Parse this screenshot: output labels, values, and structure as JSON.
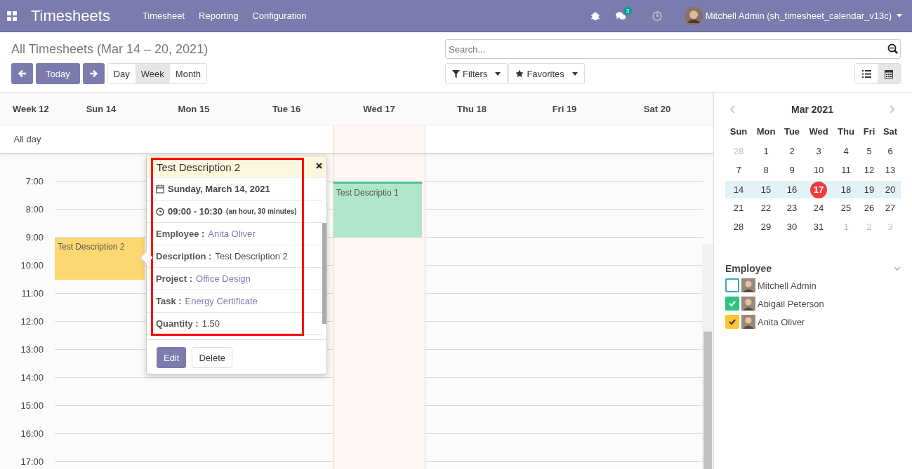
{
  "navbar": {
    "app_title": "Timesheets",
    "menus": [
      "Timesheet",
      "Reporting",
      "Configuration"
    ],
    "messages_count": "3",
    "user": "Mitchell Admin (sh_timesheet_calendar_v13c)"
  },
  "control_panel": {
    "title": "All Timesheets (Mar 14 – 20, 2021)",
    "today_button": "Today",
    "view_modes": [
      {
        "label": "Day",
        "selected": false
      },
      {
        "label": "Week",
        "selected": true
      },
      {
        "label": "Month",
        "selected": false
      }
    ],
    "search": {
      "placeholder": "Search..."
    },
    "filter_buttons": [
      {
        "kind": "filter",
        "label": "Filters"
      },
      {
        "kind": "star",
        "label": "Favorites"
      }
    ],
    "view_switch": [
      {
        "kind": "list",
        "selected": false
      },
      {
        "kind": "calendar",
        "selected": true
      }
    ]
  },
  "calendar": {
    "week_label": "Week 12",
    "all_day_label": "All day",
    "days": [
      {
        "label": "Sun 14",
        "today": false,
        "events": [
          {
            "title": "Test Description 2",
            "color": "#fcd872"
          }
        ]
      },
      {
        "label": "Mon 15",
        "today": false
      },
      {
        "label": "Tue 16",
        "today": false
      },
      {
        "label": "Wed 17",
        "today": true,
        "events": [
          {
            "title": "Test Descriptio 1",
            "color": "#b0e6cc"
          }
        ]
      },
      {
        "label": "Thu 18",
        "today": false
      },
      {
        "label": "Fri 19",
        "today": false
      },
      {
        "label": "Sat 20",
        "today": false
      }
    ],
    "hours": [
      "7:00",
      "8:00",
      "9:00",
      "10:00",
      "11:00",
      "12:00",
      "13:00",
      "14:00",
      "15:00",
      "16:00",
      "17:00"
    ]
  },
  "popover": {
    "title": "Test Description 2",
    "highlighted": true,
    "date": "Sunday, March 14, 2021",
    "time": "09:00 - 10:30",
    "duration": "(an hour, 30 minutes)",
    "fields": [
      {
        "label": "Employee :",
        "value": "Anita Oliver",
        "kind": "link"
      },
      {
        "label": "Description :",
        "value": "Test Description 2",
        "kind": "text"
      },
      {
        "label": "Project :",
        "value": "Office Design",
        "kind": "link"
      },
      {
        "label": "Task :",
        "value": "Energy Certificate",
        "kind": "link"
      },
      {
        "label": "Quantity :",
        "value": "1.50",
        "kind": "text"
      }
    ],
    "buttons": [
      {
        "label": "Edit",
        "kind": "primary"
      },
      {
        "label": "Delete",
        "kind": "secondary"
      }
    ]
  },
  "sidebar": {
    "month": "Mar 2021",
    "weekdays": [
      "Sun",
      "Mon",
      "Tue",
      "Wed",
      "Thu",
      "Fri",
      "Sat"
    ],
    "weeks": [
      {
        "selected": false,
        "days": [
          {
            "label": "28",
            "muted": true,
            "today": false
          },
          {
            "label": "1",
            "muted": false,
            "today": false
          },
          {
            "label": "2",
            "muted": false,
            "today": false
          },
          {
            "label": "3",
            "muted": false,
            "today": false
          },
          {
            "label": "4",
            "muted": false,
            "today": false
          },
          {
            "label": "5",
            "muted": false,
            "today": false
          },
          {
            "label": "6",
            "muted": false,
            "today": false
          }
        ]
      },
      {
        "selected": false,
        "days": [
          {
            "label": "7",
            "muted": false,
            "today": false
          },
          {
            "label": "8",
            "muted": false,
            "today": false
          },
          {
            "label": "9",
            "muted": false,
            "today": false
          },
          {
            "label": "10",
            "muted": false,
            "today": false
          },
          {
            "label": "11",
            "muted": false,
            "today": false
          },
          {
            "label": "12",
            "muted": false,
            "today": false
          },
          {
            "label": "13",
            "muted": false,
            "today": false
          }
        ]
      },
      {
        "selected": true,
        "days": [
          {
            "label": "14",
            "muted": false,
            "today": false
          },
          {
            "label": "15",
            "muted": false,
            "today": false
          },
          {
            "label": "16",
            "muted": false,
            "today": false
          },
          {
            "label": "17",
            "muted": false,
            "today": true
          },
          {
            "label": "18",
            "muted": false,
            "today": false
          },
          {
            "label": "19",
            "muted": false,
            "today": false
          },
          {
            "label": "20",
            "muted": false,
            "today": false
          }
        ]
      },
      {
        "selected": false,
        "days": [
          {
            "label": "21",
            "muted": false,
            "today": false
          },
          {
            "label": "22",
            "muted": false,
            "today": false
          },
          {
            "label": "23",
            "muted": false,
            "today": false
          },
          {
            "label": "24",
            "muted": false,
            "today": false
          },
          {
            "label": "25",
            "muted": false,
            "today": false
          },
          {
            "label": "26",
            "muted": false,
            "today": false
          },
          {
            "label": "27",
            "muted": false,
            "today": false
          }
        ]
      },
      {
        "selected": false,
        "days": [
          {
            "label": "28",
            "muted": false,
            "today": false
          },
          {
            "label": "29",
            "muted": false,
            "today": false
          },
          {
            "label": "30",
            "muted": false,
            "today": false
          },
          {
            "label": "31",
            "muted": false,
            "today": false
          },
          {
            "label": "1",
            "muted": true,
            "today": false
          },
          {
            "label": "2",
            "muted": true,
            "today": false
          },
          {
            "label": "3",
            "muted": true,
            "today": false
          }
        ]
      }
    ],
    "filter_title": "Employee",
    "employees": [
      {
        "name": "Mitchell Admin",
        "checked": false,
        "color": "#3aa6c0"
      },
      {
        "name": "Abigail Peterson",
        "checked": true,
        "color": "#30c381"
      },
      {
        "name": "Anita Oliver",
        "checked": true,
        "color": "#fcc534"
      }
    ]
  }
}
